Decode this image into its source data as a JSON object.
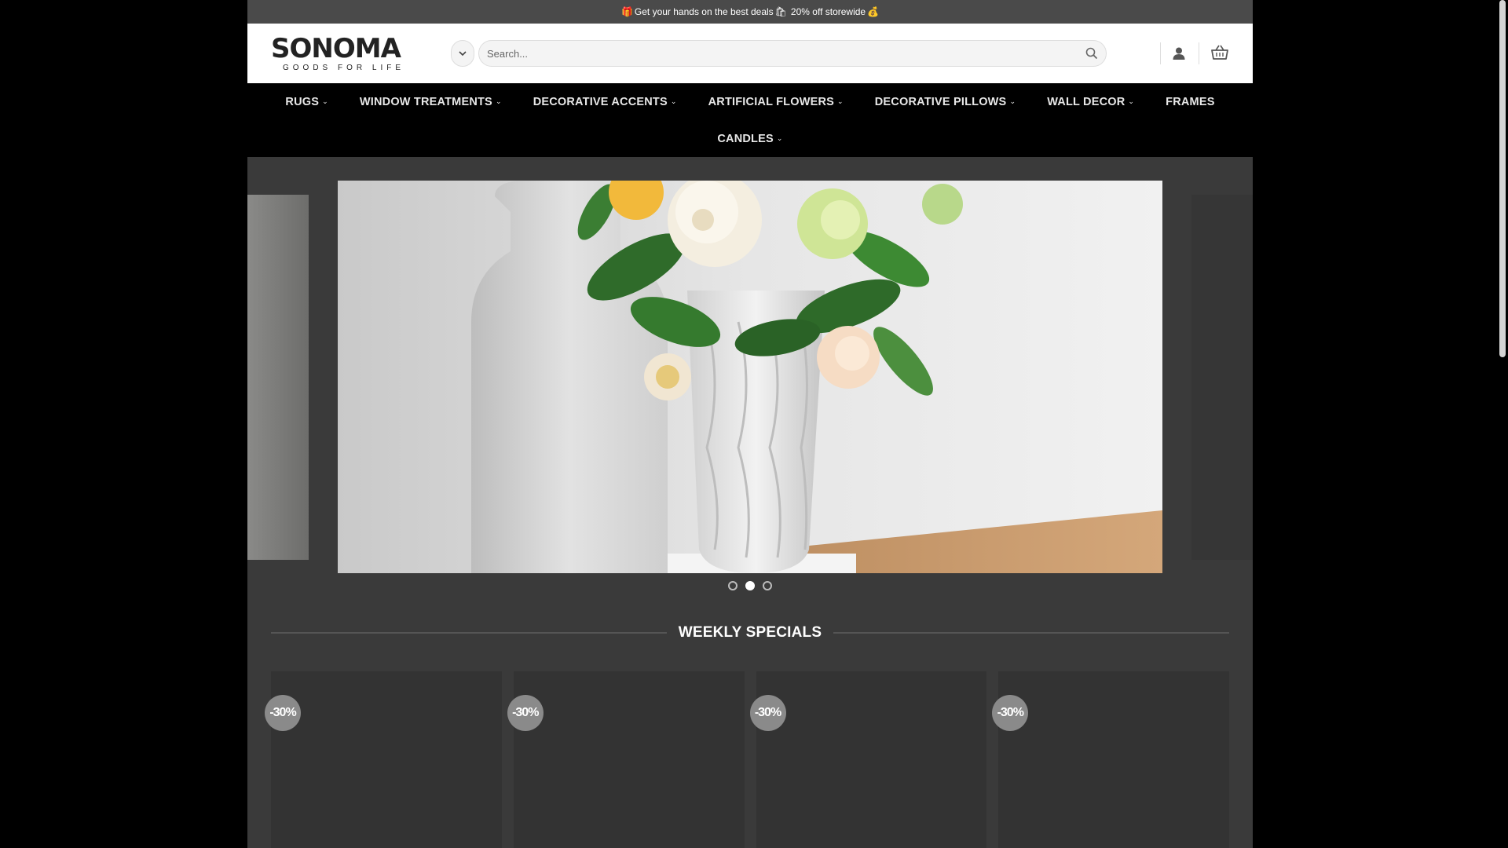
{
  "promo": {
    "text_1": "Get your hands on the best deals",
    "text_2": "20% off storewide",
    "emoji_1": "🎁",
    "emoji_2": "🛍",
    "emoji_3": "💰"
  },
  "header": {
    "logo_main": "SONOMA",
    "logo_sub": "GOODS FOR LIFE",
    "search_placeholder": "Search..."
  },
  "nav": {
    "items": [
      {
        "label": "RUGS",
        "has_dropdown": true
      },
      {
        "label": "WINDOW TREATMENTS",
        "has_dropdown": true
      },
      {
        "label": "DECORATIVE ACCENTS",
        "has_dropdown": true
      },
      {
        "label": "ARTIFICIAL FLOWERS",
        "has_dropdown": true
      },
      {
        "label": "DECORATIVE PILLOWS",
        "has_dropdown": true
      },
      {
        "label": "WALL DECOR",
        "has_dropdown": true
      },
      {
        "label": "FRAMES",
        "has_dropdown": false
      },
      {
        "label": "CANDLES",
        "has_dropdown": true
      }
    ]
  },
  "slider": {
    "active_index": 1,
    "slide_count": 3
  },
  "specials": {
    "title": "WEEKLY SPECIALS",
    "products": [
      {
        "badge": "-30%"
      },
      {
        "badge": "-30%"
      },
      {
        "badge": "-30%"
      },
      {
        "badge": "-30%"
      }
    ]
  },
  "colors": {
    "nav_bg": "#000000",
    "page_bg": "#3a3a3a",
    "badge_bg": "#8a8a8a"
  }
}
